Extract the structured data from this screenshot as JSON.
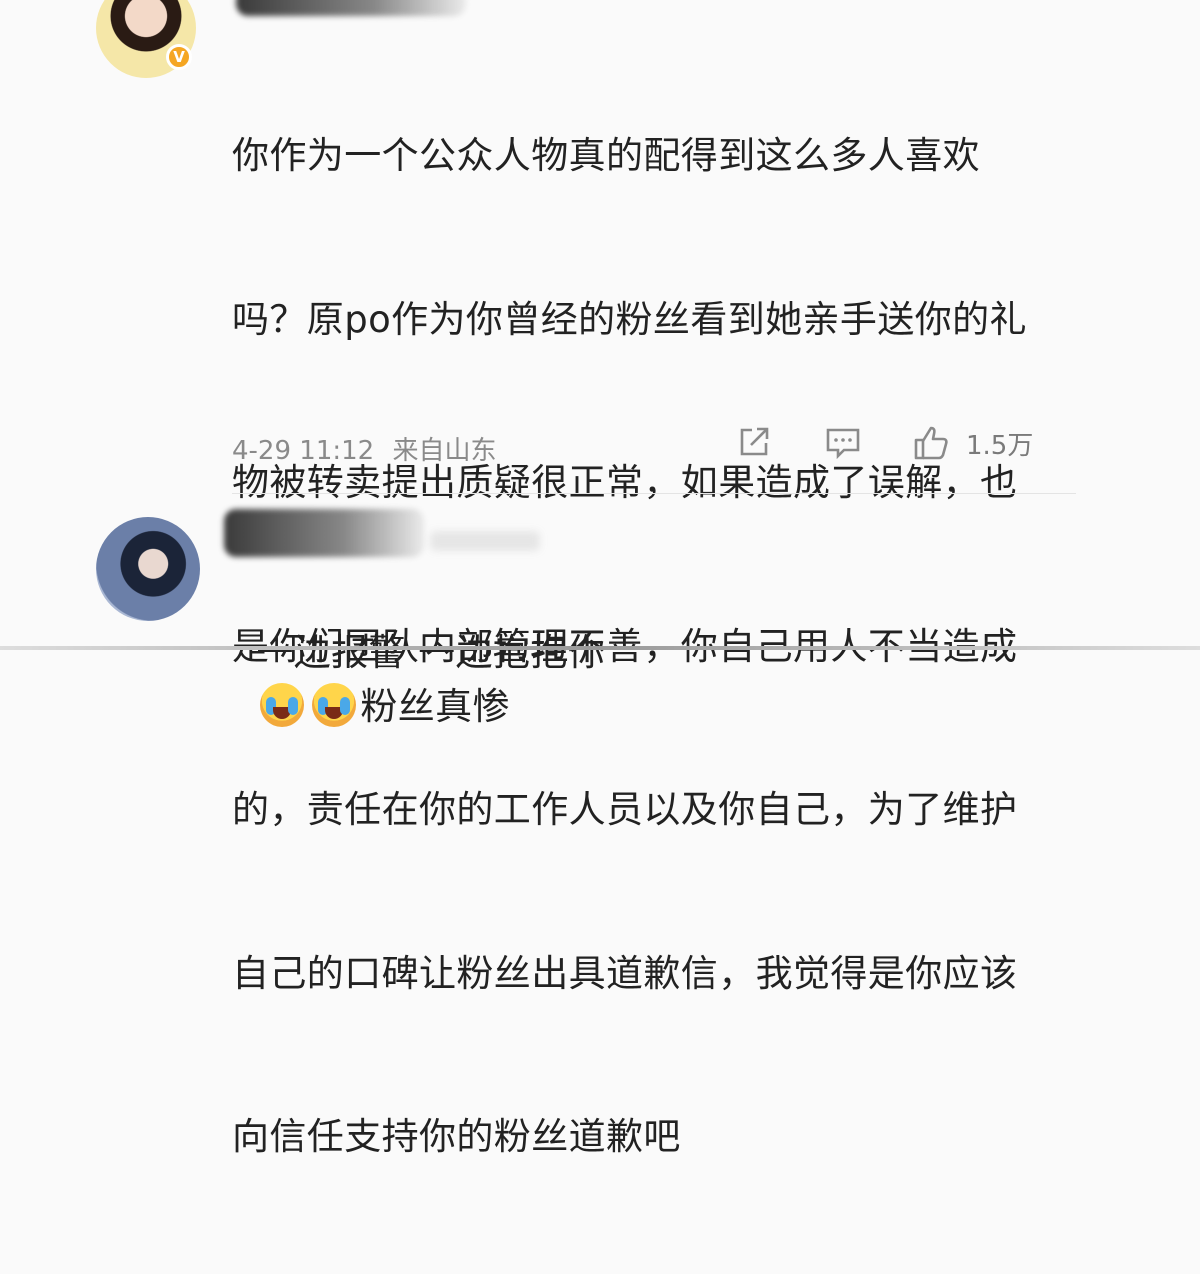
{
  "comments": [
    {
      "lines": [
        "你作为一个公众人物真的配得到这么多人喜欢",
        "吗？原po作为你曾经的粉丝看到她亲手送你的礼",
        "物被转卖提出质疑很正常，如果造成了误解，也",
        "是你们团队内部管理不善，你自己用人不当造成",
        "的，责任在你的工作人员以及你自己，为了维护",
        "自己的口碑让粉丝出具道歉信，我觉得是你应该",
        "向信任支持你的粉丝道歉吧"
      ],
      "time": "4-29 11:12",
      "location": "来自山东",
      "like_count": "1.5万",
      "icons": {
        "verified": "verified-badge-icon",
        "share": "share-icon",
        "comment": "comment-icon",
        "like": "thumbs-up-icon"
      },
      "colors": {
        "verified": "#f5a623",
        "meta": "#8a8a8a"
      }
    },
    {
      "text_part1": "一边报警 一边抱抱你",
      "emoji": "crying-laughing-emoji-icon",
      "text_part2": "粉丝真惨"
    }
  ]
}
